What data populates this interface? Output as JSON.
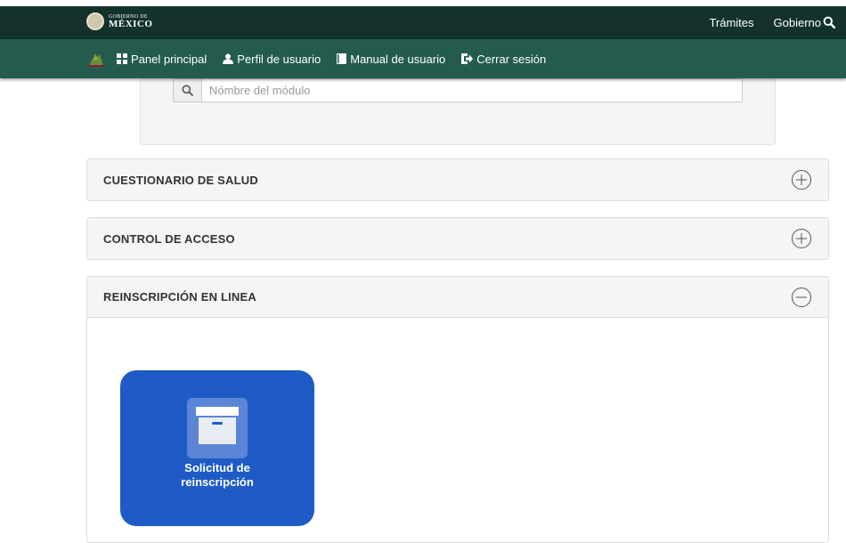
{
  "gov_bar": {
    "logo_small": "GOBIERNO DE",
    "logo_big": "MÉXICO",
    "links": [
      "Trámites",
      "Gobierno"
    ]
  },
  "nav": {
    "items": [
      {
        "label": "Panel principal",
        "icon": "grid-icon"
      },
      {
        "label": "Perfil de usuario",
        "icon": "user-icon"
      },
      {
        "label": "Manual de usuario",
        "icon": "book-icon"
      },
      {
        "label": "Cerrar sesión",
        "icon": "logout-icon"
      }
    ]
  },
  "search": {
    "placeholder": "Nómbre del módulo"
  },
  "panels": [
    {
      "title": "CUESTIONARIO DE SALUD",
      "state": "collapsed"
    },
    {
      "title": "CONTROL DE ACCESO",
      "state": "collapsed"
    },
    {
      "title": "REINSCRIPCIÓN EN LINEA",
      "state": "expanded"
    }
  ],
  "modules": [
    {
      "label_line1": "Solicitud de",
      "label_line2": "reinscripción",
      "icon": "archive-box-icon"
    }
  ],
  "colors": {
    "gov_bar": "#13322b",
    "nav_bar": "#235b4e",
    "module_tile": "#1e5bc6"
  }
}
